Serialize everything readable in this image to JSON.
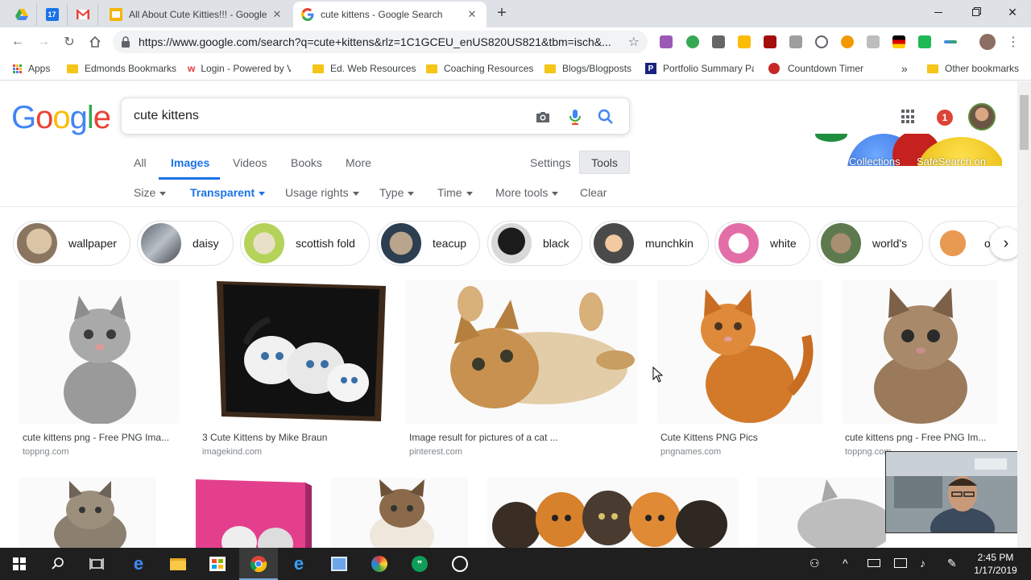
{
  "browser": {
    "pinned_tabs": [
      {
        "name": "google-drive-icon"
      },
      {
        "name": "calendar-icon",
        "label": "17"
      },
      {
        "name": "gmail-icon"
      }
    ],
    "tabs": [
      {
        "title": "All About Cute Kitties!!! - Google",
        "icon": "slides-icon",
        "active": false
      },
      {
        "title": "cute kittens - Google Search",
        "icon": "google-g-icon",
        "active": true
      }
    ],
    "url": "https://www.google.com/search?q=cute+kittens&rlz=1C1GCEU_enUS820US821&tbm=isch&...",
    "bookmarks": [
      {
        "label": "Apps",
        "icon": "apps-grid-icon"
      },
      {
        "label": "Edmonds Bookmarks",
        "icon": "folder-icon"
      },
      {
        "label": "Login - Powered by V",
        "icon": "w-logo-icon"
      },
      {
        "label": "Ed. Web Resources",
        "icon": "folder-icon"
      },
      {
        "label": "Coaching Resources",
        "icon": "folder-icon"
      },
      {
        "label": "Blogs/Blogposts",
        "icon": "folder-icon"
      },
      {
        "label": "Portfolio Summary Pa",
        "icon": "p-logo-icon"
      },
      {
        "label": "Countdown Timer",
        "icon": "timer-icon"
      },
      {
        "label": "Other bookmarks",
        "icon": "folder-icon"
      }
    ],
    "bookmarks_overflow": "»"
  },
  "google": {
    "logo_letters": [
      {
        "ch": "G",
        "color": "#4285f4"
      },
      {
        "ch": "o",
        "color": "#ea4335"
      },
      {
        "ch": "o",
        "color": "#fbbc05"
      },
      {
        "ch": "g",
        "color": "#4285f4"
      },
      {
        "ch": "l",
        "color": "#34a853"
      },
      {
        "ch": "e",
        "color": "#ea4335"
      }
    ],
    "query": "cute kittens",
    "notification_count": "1",
    "doodle_labels": {
      "left": "Collections",
      "right": "SafeSearch on"
    },
    "tabs": [
      "All",
      "Images",
      "Videos",
      "Books",
      "More"
    ],
    "active_tab": "Images",
    "settings": "Settings",
    "tools": "Tools",
    "filters": [
      {
        "label": "Size",
        "active": false
      },
      {
        "label": "Transparent",
        "active": true
      },
      {
        "label": "Usage rights",
        "active": false
      },
      {
        "label": "Type",
        "active": false
      },
      {
        "label": "Time",
        "active": false
      },
      {
        "label": "More tools",
        "active": false
      }
    ],
    "clear": "Clear",
    "chips": [
      "wallpaper",
      "daisy",
      "scottish fold",
      "teacup",
      "black",
      "munchkin",
      "white",
      "world's",
      "o"
    ],
    "results_row1": [
      {
        "title": "cute kittens png - Free PNG Ima...",
        "source": "toppng.com"
      },
      {
        "title": "3 Cute Kittens by Mike Braun",
        "source": "imagekind.com"
      },
      {
        "title": "Image result for pictures of a cat ...",
        "source": "pinterest.com"
      },
      {
        "title": "Cute Kittens PNG Pics",
        "source": "pngnames.com"
      },
      {
        "title": "cute kittens png - Free PNG Im...",
        "source": "toppng.com"
      }
    ]
  },
  "taskbar": {
    "time": "2:45 PM",
    "date": "1/17/2019"
  },
  "colors": {
    "google_blue": "#1a73e8",
    "tab_strip": "#dee1e6",
    "taskbar": "#1f1f1f"
  }
}
